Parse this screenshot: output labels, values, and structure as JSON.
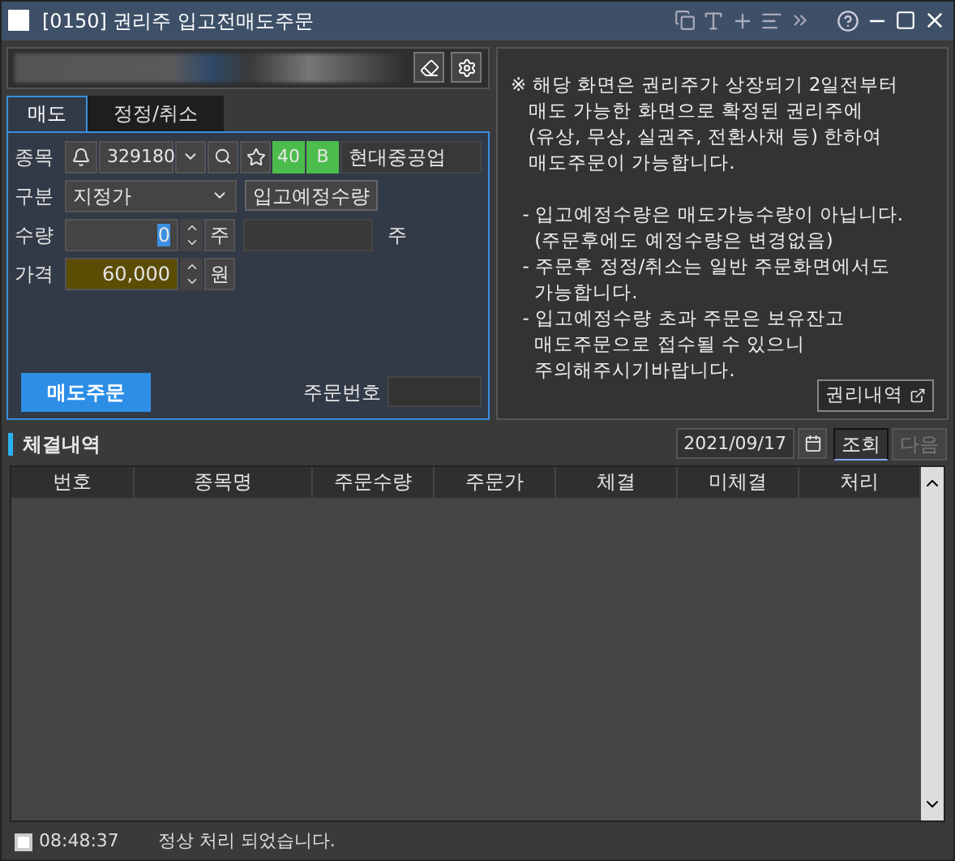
{
  "window": {
    "title": "[0150] 권리주 입고전매도주문"
  },
  "tabs": [
    {
      "label": "매도",
      "selected": true
    },
    {
      "label": "정정/취소",
      "selected": false
    }
  ],
  "form": {
    "code_label": "종목",
    "code": "329180",
    "badge_1": "40",
    "badge_2": "B",
    "stock_name": "현대중공업",
    "type_label": "구분",
    "type_value": "지정가",
    "expected_button": "입고예정수량",
    "qty_label": "수량",
    "qty_value": "0",
    "qty_unit": "주",
    "qty_unit_2": "주",
    "price_label": "가격",
    "price_value": "60,000",
    "price_unit": "원",
    "order_button": "매도주문",
    "order_no_label": "주문번호"
  },
  "notice": {
    "paragraphs": [
      [
        "※ 해당 화면은 권리주가 상장되기 2일전부터",
        "   매도 가능한 화면으로 확정된 권리주에",
        "   (유상, 무상, 실권주, 전환사채 등) 한하여",
        "   매도주문이 가능합니다."
      ],
      [
        "  - 입고예정수량은 매도가능수량이 아닙니다.",
        "    (주문후에도 예정수량은 변경없음)",
        "  - 주문후 정정/취소는 일반 주문화면에서도",
        "    가능합니다.",
        "  - 입고예정수량 초과 주문은 보유잔고",
        "    매도주문으로 접수될 수 있으니",
        "    주의해주시기바랍니다."
      ]
    ],
    "button": "권리내역"
  },
  "executions": {
    "title": "체결내역",
    "date": "2021/09/17",
    "query_button": "조회",
    "next_button": {
      "label": "다음",
      "disabled": true
    },
    "columns": [
      "번호",
      "종목명",
      "주문수량",
      "주문가",
      "체결",
      "미체결",
      "처리"
    ]
  },
  "status_bar": {
    "time": "08:48:37",
    "message": "정상 처리 되었습니다."
  }
}
